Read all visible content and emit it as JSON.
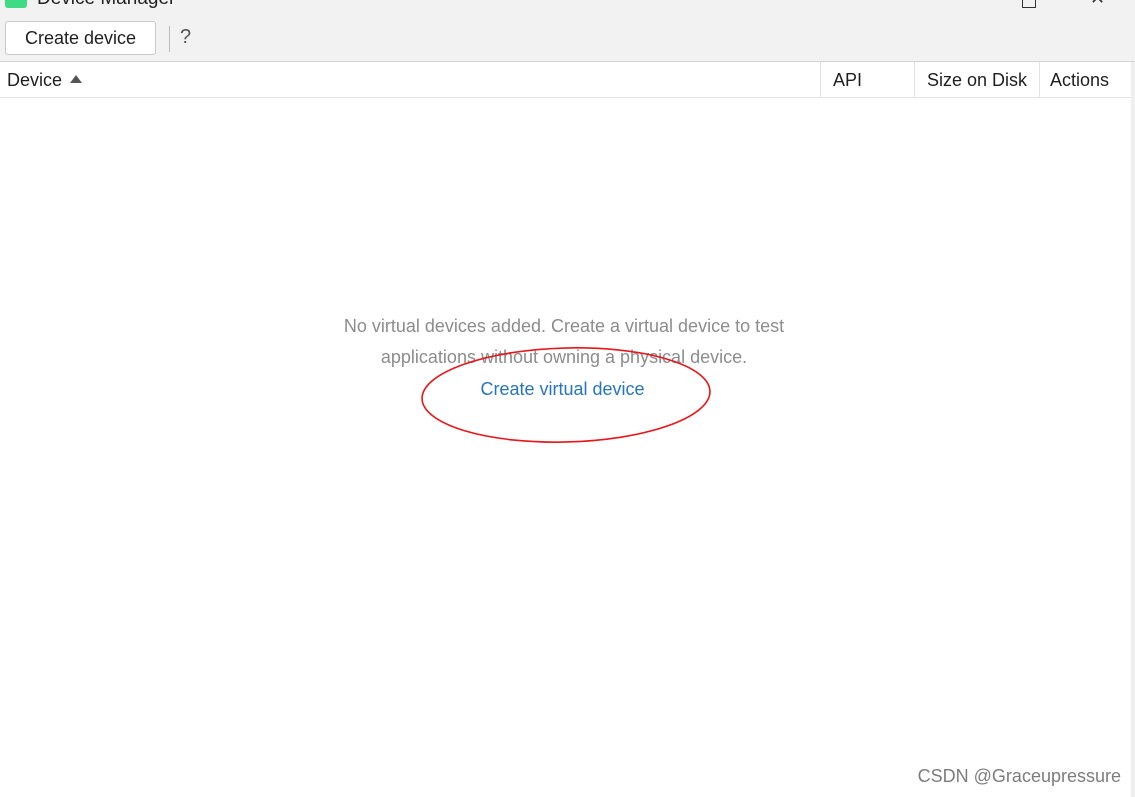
{
  "window": {
    "title": "Device Manager",
    "maximize_icon": "maximize-icon",
    "close_icon": "close-icon"
  },
  "toolbar": {
    "create_label": "Create device",
    "help_label": "?"
  },
  "table": {
    "columns": [
      "Device",
      "API",
      "Size on Disk",
      "Actions"
    ],
    "sort_icon": "sort-ascending-icon"
  },
  "empty_state": {
    "line1": "No virtual devices added. Create a virtual device to test",
    "line2": "applications without owning a physical device.",
    "link_label": "Create virtual device",
    "highlight_color": "#e8151b"
  },
  "watermark": "CSDN @Graceupressure"
}
